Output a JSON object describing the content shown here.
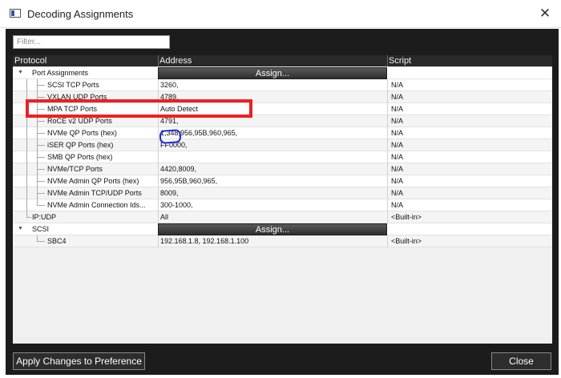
{
  "window": {
    "title": "Decoding Assignments"
  },
  "filter": {
    "placeholder": "Filter..."
  },
  "table": {
    "columns": [
      "Protocol",
      "Address",
      "Script"
    ],
    "assign_label": "Assign...",
    "groups": [
      {
        "label": "Port Assignments"
      },
      {
        "label": "IP:UDP"
      },
      {
        "label": "SCSI"
      }
    ],
    "rows": [
      {
        "protocol": "SCSI TCP Ports",
        "address": "3260,",
        "script": "N/A"
      },
      {
        "protocol": "VXLAN UDP Ports",
        "address": "4789,",
        "script": "N/A"
      },
      {
        "protocol": "MPA TCP Ports",
        "address": "Auto Detect",
        "script": "N/A"
      },
      {
        "protocol": "RoCE v2 UDP Ports",
        "address": "4791,",
        "script": "N/A"
      },
      {
        "protocol": "NVMe QP Ports (hex)",
        "address": "1,348,956,95B,960,965,",
        "script": "N/A"
      },
      {
        "protocol": "iSER QP Ports (hex)",
        "address": "FF0000,",
        "script": "N/A"
      },
      {
        "protocol": "SMB QP Ports (hex)",
        "address": "",
        "script": "N/A"
      },
      {
        "protocol": "NVMe/TCP Ports",
        "address": "4420,8009,",
        "script": "N/A"
      },
      {
        "protocol": "NVMe Admin QP Ports (hex)",
        "address": "956,95B,960,965,",
        "script": "N/A"
      },
      {
        "protocol": "NVMe Admin TCP/UDP Ports",
        "address": "8009,",
        "script": "N/A"
      },
      {
        "protocol": "NVMe Admin Connection Ids...",
        "address": "300-1000,",
        "script": "N/A"
      }
    ],
    "ipudp": {
      "address": "All",
      "script": "<Built-in>"
    },
    "scsi_child": {
      "protocol": "SBC4",
      "address": "192.168.1.8, 192.168.1.100",
      "script": "<Built-in>"
    }
  },
  "buttons": {
    "apply": "Apply Changes to Preference",
    "close": "Close"
  },
  "colors": {
    "dialog_bg": "#1c1c1c",
    "highlight_box": "#ef1f1f",
    "annotation_circle": "#1a2ed8"
  }
}
